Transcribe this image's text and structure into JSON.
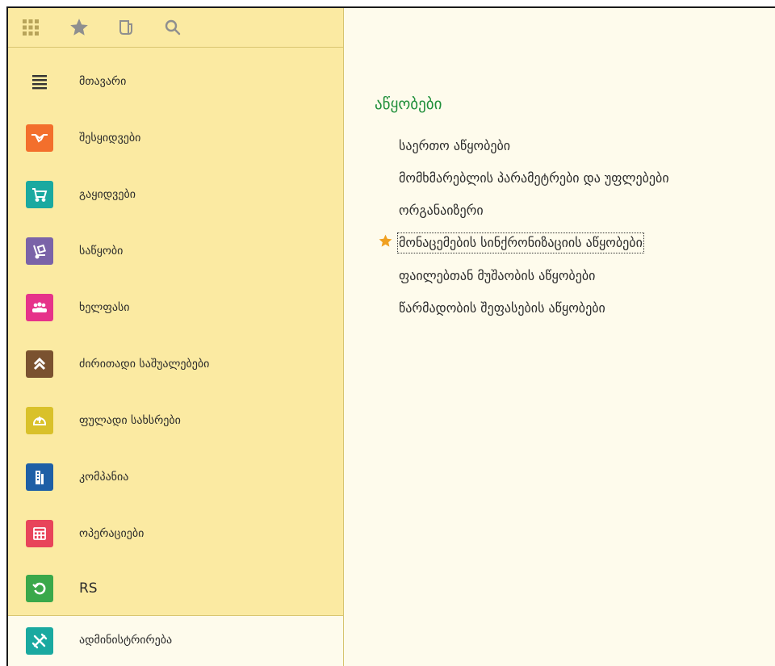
{
  "toolbar": {
    "icons": [
      "apps-grid-icon",
      "star-icon",
      "history-icon",
      "search-icon"
    ],
    "grid_color": "#b8a45a"
  },
  "sidebar": {
    "items": [
      {
        "label": "მთავარი",
        "icon": "menu-lines-icon",
        "color": ""
      },
      {
        "label": "შესყიდვები",
        "icon": "handshake-icon",
        "color": "#f36f2c"
      },
      {
        "label": "გაყიდვები",
        "icon": "cart-icon",
        "color": "#1aa9a0"
      },
      {
        "label": "საწყობი",
        "icon": "dolly-icon",
        "color": "#7a63a8"
      },
      {
        "label": "ხელფასი",
        "icon": "people-icon",
        "color": "#e6338a"
      },
      {
        "label": "ძირითადი საშუალებები",
        "icon": "chevrons-up-icon",
        "color": "#7a5230"
      },
      {
        "label": "ფულადი სახსრები",
        "icon": "coin-icon",
        "color": "#d9c12a"
      },
      {
        "label": "კომპანია",
        "icon": "building-icon",
        "color": "#1e5fa6"
      },
      {
        "label": "ოპერაციები",
        "icon": "calculator-icon",
        "color": "#e8445a"
      },
      {
        "label": "RS",
        "icon": "refresh-icon",
        "color": "#3aa84a"
      }
    ],
    "admin": {
      "label": "ადმინისტრირება",
      "icon": "tools-icon",
      "color": "#1aa9a0"
    }
  },
  "content": {
    "title": "აწყობები",
    "links": [
      {
        "label": "საერთო აწყობები",
        "favorite": false
      },
      {
        "label": "მომხმარებლის პარამეტრები და უფლებები",
        "favorite": false
      },
      {
        "label": "ორგანაიზერი",
        "favorite": false
      },
      {
        "label": "მონაცემების სინქრონიზაციის აწყობები",
        "favorite": true
      },
      {
        "label": "ფაილებთან მუშაობის აწყობები",
        "favorite": false
      },
      {
        "label": "წარმადობის შეფასების აწყობები",
        "favorite": false
      }
    ],
    "accent_color": "#1f8f3a",
    "star_color": "#f0a020"
  }
}
